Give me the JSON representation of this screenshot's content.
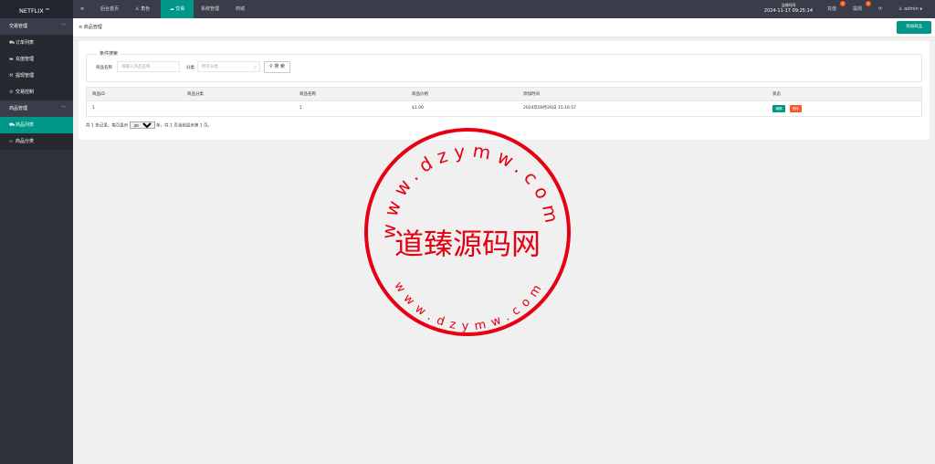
{
  "brand": {
    "name": "NETFLIX",
    "sup": "H5"
  },
  "topbar": {
    "menu_toggle": "≡",
    "nav": [
      {
        "label": "后台首页"
      },
      {
        "label": "角色",
        "icon": "user-icon"
      },
      {
        "label": "交易",
        "icon": "group-icon"
      },
      {
        "label": "系统管理"
      },
      {
        "label": "商城"
      }
    ],
    "time_label": "当前时间",
    "time_value": "2024-11-17 09:25:14",
    "recharge": {
      "label": "充值",
      "badge": "0"
    },
    "withdraw": {
      "label": "提现",
      "badge": "0"
    },
    "refresh_icon": "refresh-icon",
    "user": "admin"
  },
  "sidebar": {
    "groups": [
      {
        "label": "交易管理",
        "items": [
          {
            "label": "订单列表",
            "icon": "cart-icon"
          },
          {
            "label": "充值管理",
            "icon": "message-icon"
          },
          {
            "label": "提现管理",
            "icon": "wrench-icon"
          },
          {
            "label": "交易控制",
            "icon": "check-circle-icon"
          }
        ]
      },
      {
        "label": "商品管理",
        "items": [
          {
            "label": "商品列表",
            "icon": "cart-icon",
            "active": true
          },
          {
            "label": "商品分类",
            "icon": "link-icon"
          }
        ]
      }
    ]
  },
  "page": {
    "breadcrumb": "商品管理",
    "add_button": "添加商品"
  },
  "filter": {
    "legend": "条件搜索",
    "name_label": "商品名称",
    "name_placeholder": "请输入商品名称",
    "category_label": "分类",
    "category_placeholder": "所有分类",
    "search_button": "搜 索"
  },
  "table": {
    "columns": [
      "商品ID",
      "商品分类",
      "商品名称",
      "商品价格",
      "添加时间",
      "状态"
    ],
    "rows": [
      {
        "id": "1",
        "category": "",
        "name": "1",
        "price": "$1.00",
        "time": "2024年09月26日 15:16:57",
        "edit": "编辑",
        "delete": "删除"
      }
    ]
  },
  "pager": {
    "prefix": "共 1 条记录，每页显示",
    "per_page": "20",
    "suffix": "条，共 1 页当前显示第 1 页。"
  },
  "watermark": {
    "text": "道臻源码网",
    "url_outer": "www.dzymw.com",
    "url_inner": "www.dzymw.com",
    "color": "#e60012"
  }
}
